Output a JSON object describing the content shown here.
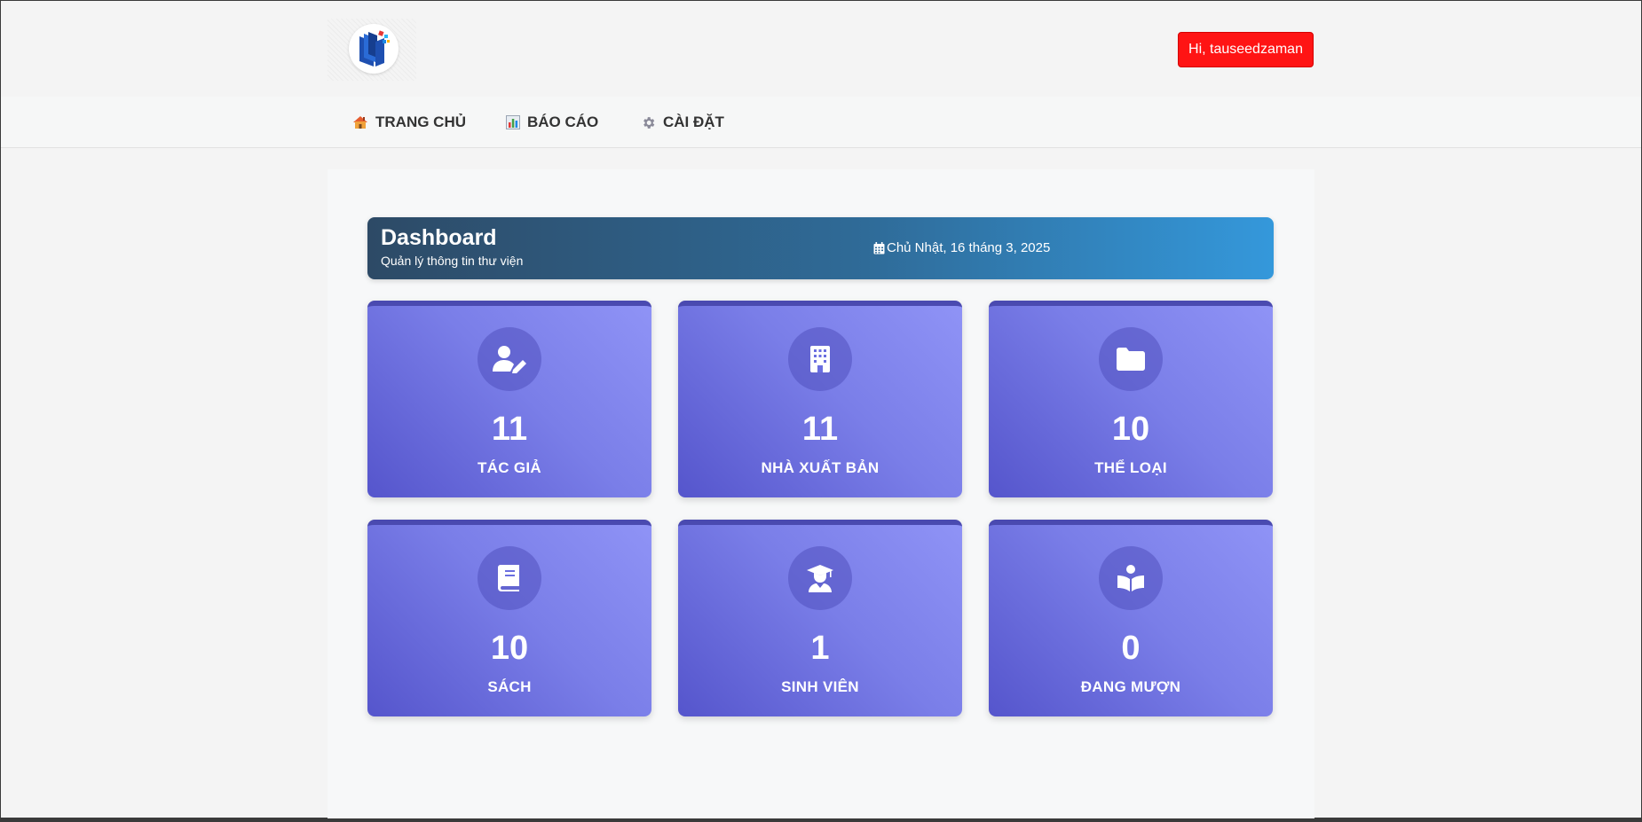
{
  "header": {
    "user_greeting": "Hi, tauseedzaman"
  },
  "nav": {
    "items": [
      {
        "label": "TRANG CHỦ",
        "icon": "house-icon"
      },
      {
        "label": "BÁO CÁO",
        "icon": "bar-chart-icon"
      },
      {
        "label": "CÀI ĐẶT",
        "icon": "gear-icon"
      }
    ]
  },
  "hero": {
    "title": "Dashboard",
    "subtitle": "Quản lý thông tin thư viện",
    "date": "Chủ Nhật, 16 tháng 3, 2025"
  },
  "stats": [
    {
      "value": "11",
      "label": "TÁC GIẢ",
      "icon": "author-pen-icon"
    },
    {
      "value": "11",
      "label": "NHÀ XUẤT BẢN",
      "icon": "building-icon"
    },
    {
      "value": "10",
      "label": "THỂ LOẠI",
      "icon": "folder-icon"
    },
    {
      "value": "10",
      "label": "SÁCH",
      "icon": "book-icon"
    },
    {
      "value": "1",
      "label": "SINH VIÊN",
      "icon": "graduate-icon"
    },
    {
      "value": "0",
      "label": "ĐANG MƯỢN",
      "icon": "reading-icon"
    }
  ],
  "colors": {
    "user_button": "#ff1414",
    "hero_start": "#2d4a66",
    "hero_end": "#3498db",
    "card_start": "#5555cc",
    "card_end": "#8f93f6"
  }
}
